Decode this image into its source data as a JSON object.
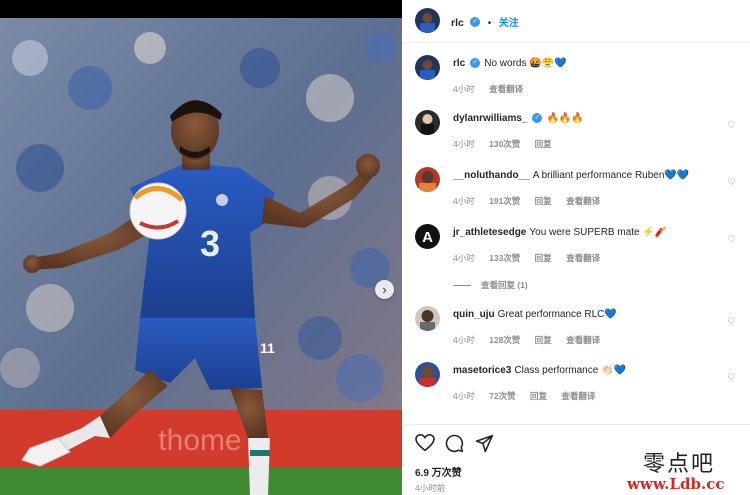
{
  "post": {
    "username": "rlc",
    "follow_label": "关注",
    "likes": "6.9 万次赞",
    "time": "4小时前"
  },
  "caption": {
    "username": "rlc",
    "text": "No words 🤬😤💙",
    "time": "4小时",
    "translate": "查看翻译"
  },
  "comments": [
    {
      "username": "dylanrwilliams_",
      "verified": true,
      "text": "🔥🔥🔥",
      "time": "4小时",
      "likes": "130次赞",
      "reply": "回复",
      "translate": ""
    },
    {
      "username": "__noluthando__",
      "verified": false,
      "text": "A brilliant performance Ruben💙💙",
      "time": "4小时",
      "likes": "191次赞",
      "reply": "回复",
      "translate": "查看翻译"
    },
    {
      "username": "jr_athletesedge",
      "verified": false,
      "text": "You were SUPERB mate ⚡🧨",
      "time": "4小时",
      "likes": "133次赞",
      "reply": "回复",
      "translate": "查看翻译"
    },
    {
      "username": "quin_uju",
      "verified": false,
      "text": "Great performance RLC💙",
      "time": "4小时",
      "likes": "128次赞",
      "reply": "回复",
      "translate": "查看翻译"
    },
    {
      "username": "masetorice3",
      "verified": false,
      "text": "Class performance 👏🏻💙",
      "time": "4小时",
      "likes": "72次赞",
      "reply": "回复",
      "translate": "查看翻译"
    }
  ],
  "view_replies": "查看回复 (1)",
  "icons": {
    "like": "heart-icon",
    "comment": "comment-icon",
    "share": "share-icon",
    "next": "chevron-right-icon"
  },
  "watermark": {
    "cn": "零点吧",
    "url": "www.Ldb.cc"
  },
  "colors": {
    "verified": "#3897f0",
    "follow": "#0095f6",
    "chelsea_blue": "#1f4fa8",
    "pitch_green": "#3f8a32",
    "watermark_red": "#e0241b"
  }
}
